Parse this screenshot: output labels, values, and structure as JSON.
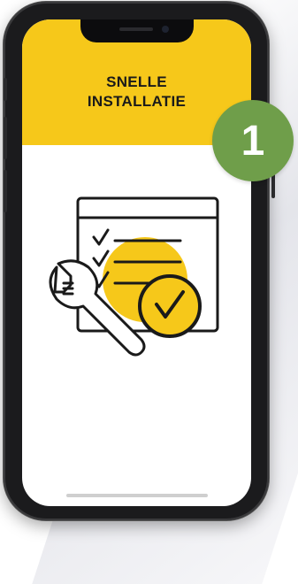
{
  "screen": {
    "title_line1": "SNELLE",
    "title_line2": "INSTALLATIE"
  },
  "badge": {
    "number": "1"
  },
  "colors": {
    "accent_yellow": "#f6c81a",
    "badge_green": "#6f9e4a",
    "phone_frame": "#1b1b1d",
    "icon_stroke": "#1a1a1a"
  },
  "icons": [
    "checklist-window-icon",
    "wrench-icon",
    "check-circle-icon"
  ]
}
